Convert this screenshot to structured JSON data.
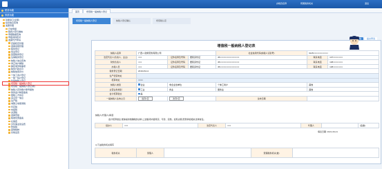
{
  "topbar": {
    "left": "",
    "user": "办税员名称",
    "org": "所属税务机关",
    "logout": "退出"
  },
  "sidebar": {
    "head1": "税务功能",
    "head2": "系统功能",
    "items": [
      "功能窗口(全部)",
      "综合信息查询",
      "发票管理",
      "日常申报",
      "税费计算与缴纳",
      "申报数据查询",
      "申报资料核对",
      "发票代开申请",
      "定额核定管理",
      "发票领用管理",
      "税务登记",
      "停业登记",
      "变更税务登记",
      "注销税务登记",
      "纳税人信息查询",
      "非正常户解除",
      "跨区域涉税事项",
      "税务行政许可",
      "纳税信用评价",
      "个体工商户登记",
      "一照一码户登记",
      "外埠纳税人登记",
      "增值税一般纳税人登记",
      "增值税一般纳税人登记(新)",
      "纳税人存款账户账号报告",
      "财务会计制度备案",
      "银税三方协议",
      "多证合一信息",
      "房产税",
      "城镇土地使用税",
      "印花税",
      "车船税",
      "资源税",
      "发票查验",
      "税收优惠备案",
      "社保费",
      "文化事业建设费",
      "附加税",
      "其他税种",
      "系统设置"
    ]
  },
  "tabs": [
    "首页",
    "增值税一般纳税人登记"
  ],
  "steps": [
    "增值税一般纳税人登记",
    "纳税人登记确认",
    "增值税认定"
  ],
  "buttons": {
    "save": "保存草稿",
    "submit": "提交申请"
  },
  "form": {
    "title": "增值税一般纳税人登记表",
    "row1": {
      "l1": "纳税人名称",
      "v1": "广西××建筑劳务有限公司",
      "l2": "社会信用代码(纳税人识别号)",
      "v2": "9145××××××××××××"
    },
    "row2": {
      "l1": "法定代表人(负责人、业主)",
      "v1": "×××",
      "l2": "证件名称及号码",
      "v2": "居民身份证",
      "v3": "45××××××××××××××××",
      "l4": "联系电话",
      "v4": "137××××××××"
    },
    "row3": {
      "l1": "财务负责人",
      "v1": "×××",
      "l2": "证件名称及号码",
      "v2": "居民身份证",
      "v3": "45××××××××××××××××",
      "l4": "联系电话",
      "v4": "138××××××××"
    },
    "row4": {
      "l1": "办税人员",
      "v1": "×××",
      "l2": "证件名称及号码",
      "v2": "居民身份证",
      "v3": "45××××××××××××××××",
      "l4": "联系电话",
      "v4": "138××××××××"
    },
    "row5": {
      "l1": "税务登记日期",
      "v1": "2019-09-11"
    },
    "row6": {
      "l1": "生产经营地址",
      "v1": ""
    },
    "row7": {
      "l1": "核算地址",
      "v1": "××××"
    },
    "row8": {
      "l1": "纳税人类别",
      "v1": "企业",
      "l2": "非企业性单位",
      "l3": "个体工商户",
      "l4": "其他"
    },
    "row9": {
      "l1": "主营业务类别",
      "v1": "工业",
      "v2": "商业",
      "v3": "服务业",
      "v4": "其他"
    },
    "row10": {
      "l1": "会计核算健全",
      "v1": "是"
    },
    "row11": {
      "l1": "一般纳税人生效之日",
      "v1": "当月1日",
      "v2": "次月1日",
      "l3": "生效日期"
    },
    "note1": "纳税人(代理人)承诺:",
    "note2": "会计核算健全,能够提供准确税务资料,上述各项内容真实、可靠、完整。如有虚假,愿意承担相关法律责任。",
    "agent": {
      "l1": "经办人",
      "v1": "×××",
      "l2": "法定代表人",
      "v2": "×××",
      "l3": "代理人",
      "v3": "",
      "l4": "(签章)"
    },
    "date": {
      "l": "填表日期",
      "v": "2021-09-21"
    },
    "taxoffice": "以下由税务机关填写",
    "recv": {
      "l1": "受理人",
      "v1": "",
      "l2": "受理税务机关(章)",
      "v2": ""
    },
    "recvtitle": "税务机关"
  }
}
